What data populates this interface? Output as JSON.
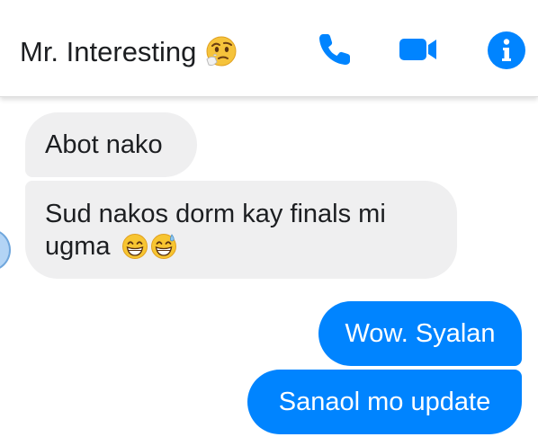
{
  "header": {
    "contact_name": "Mr. Interesting",
    "title_emoji": "thinking-face",
    "actions": [
      {
        "name": "phone-icon",
        "label": "call"
      },
      {
        "name": "video-camera-icon",
        "label": "video call"
      },
      {
        "name": "info-icon",
        "label": "info"
      }
    ]
  },
  "messages": [
    {
      "sender": "contact",
      "text": "Abot nako"
    },
    {
      "sender": "contact",
      "text_line1": "Sud nakos dorm kay finals mi",
      "text_line2": "ugma",
      "emojis": [
        "grinning-face-with-smiling-eyes",
        "grinning-face-with-sweat"
      ]
    },
    {
      "sender": "me",
      "text": "Wow. Syalan"
    },
    {
      "sender": "me",
      "text": "Sanaol mo update"
    }
  ],
  "colors": {
    "accent": "#0084ff",
    "incoming_bubble": "#efeff0",
    "outgoing_text": "#ffffff",
    "title_text": "#1c1e21"
  }
}
